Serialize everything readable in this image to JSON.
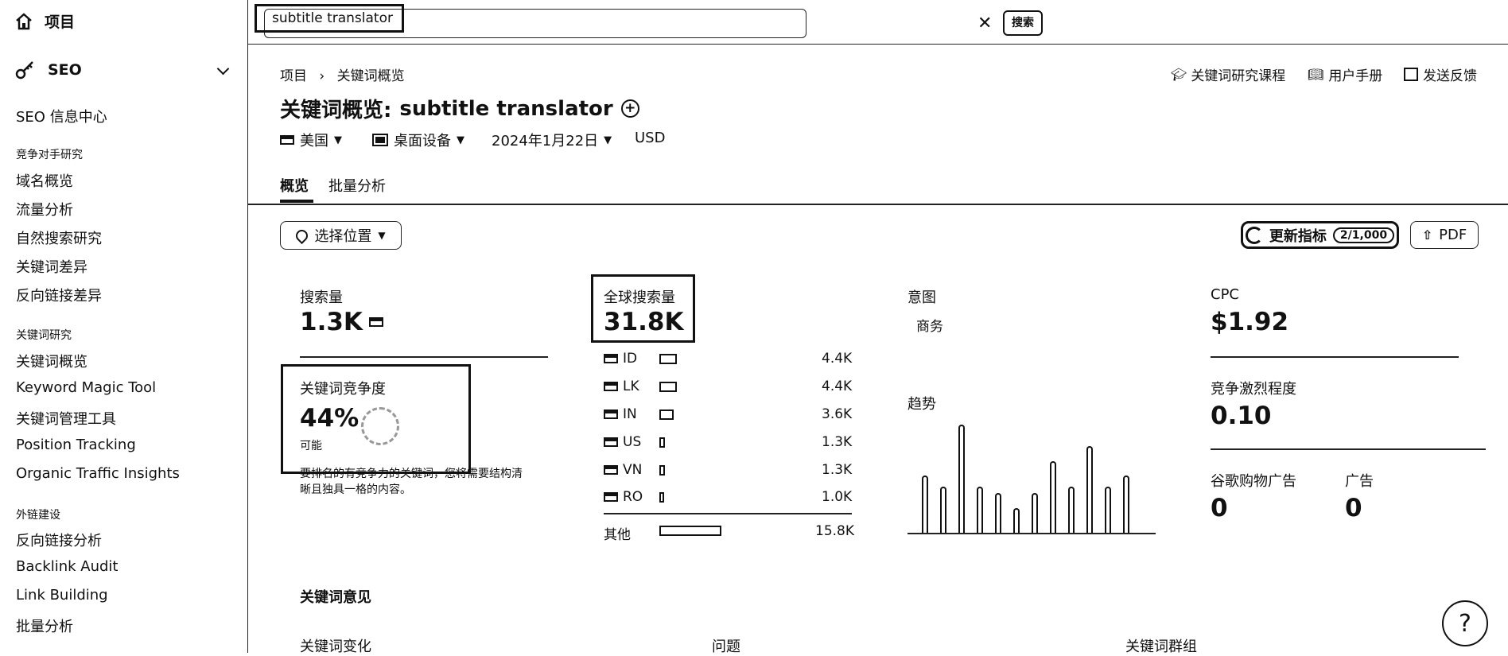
{
  "sidebar": {
    "home_label": "项目",
    "seo_label": "SEO",
    "seo_center": "SEO 信息中心",
    "groups": [
      {
        "title": "竞争对手研究",
        "items": [
          "域名概览",
          "流量分析",
          "自然搜索研究",
          "关键词差异",
          "反向链接差异"
        ]
      },
      {
        "title": "关键词研究",
        "items": [
          "关键词概览",
          "Keyword Magic Tool",
          "关键词管理工具",
          "Position Tracking",
          "Organic Traffic Insights"
        ]
      },
      {
        "title": "外链建设",
        "items": [
          "反向链接分析",
          "Backlink Audit",
          "Link Building",
          "批量分析"
        ]
      }
    ]
  },
  "search": {
    "value": "subtitle translator",
    "button_label": "搜索"
  },
  "breadcrumb": {
    "root": "项目",
    "current": "关键词概览"
  },
  "header_links": {
    "course": "关键词研究课程",
    "manual": "用户手册",
    "feedback": "发送反馈"
  },
  "page": {
    "title_prefix": "关键词概览:",
    "keyword": "subtitle translator"
  },
  "filters": {
    "country": "美国",
    "device": "桌面设备",
    "date": "2024年1月22日",
    "currency": "USD"
  },
  "tabs": [
    "概览",
    "批量分析"
  ],
  "location_button": "选择位置",
  "update_metrics": {
    "label": "更新指标",
    "count": "2/1,000"
  },
  "pdf_label": "PDF",
  "volume": {
    "label": "搜索量",
    "value": "1.3K"
  },
  "difficulty": {
    "label": "关键词竞争度",
    "value": "44%",
    "level": "可能",
    "description_line1": "要排名的有竞争力的关键词，您将需要结构清",
    "description_line2": "晰且独具一格的内容。"
  },
  "global_volume": {
    "label": "全球搜索量",
    "value": "31.8K",
    "countries": [
      {
        "code": "ID",
        "value": "4.4K"
      },
      {
        "code": "LK",
        "value": "4.4K"
      },
      {
        "code": "IN",
        "value": "3.6K"
      },
      {
        "code": "US",
        "value": "1.3K"
      },
      {
        "code": "VN",
        "value": "1.3K"
      },
      {
        "code": "RO",
        "value": "1.0K"
      }
    ],
    "other_label": "其他",
    "other_value": "15.8K"
  },
  "intent": {
    "label": "意图",
    "value": "商务"
  },
  "trend": {
    "label": "趋势",
    "values": [
      0.53,
      0.43,
      1.0,
      0.43,
      0.37,
      0.23,
      0.37,
      0.66,
      0.43,
      0.8,
      0.43,
      0.53
    ]
  },
  "cpc": {
    "label": "CPC",
    "value": "$1.92"
  },
  "competition": {
    "label": "竞争激烈程度",
    "value": "0.10"
  },
  "shopping_ads": {
    "label": "谷歌购物广告",
    "value": "0"
  },
  "ads": {
    "label": "广告",
    "value": "0"
  },
  "ideas": {
    "title": "关键词意见",
    "columns": [
      "关键词变化",
      "问题",
      "关键词群组"
    ]
  },
  "help_label": "?"
}
